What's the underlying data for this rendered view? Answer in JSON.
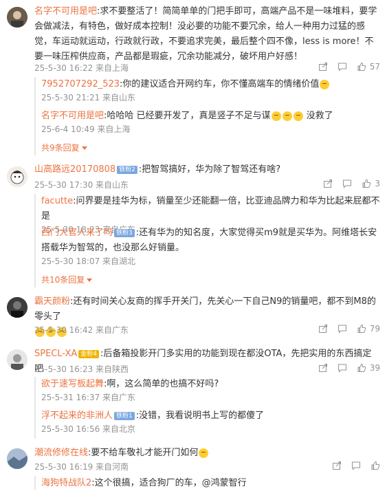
{
  "comments": [
    {
      "user": "名字不可用是吧",
      "text": ":求不要整活了！简简单单的门把手即可，高端产品不是一味堆料，要学会做减法，有特色，做好成本控制！没必要的功能不要冗余，给人一种用力过猛的感觉，车运动就运动，行政就行政，不要追求完美，最后整个四不像，less is more！不要一味压榨供应商，产品都是瑕疵，冗余功能减分，破坏用户好感！",
      "meta": "25-5-30 16:22 来自上海",
      "likes": "57",
      "replies": [
        {
          "user": "7952707292_523",
          "text": ":你的建议适合开网约车，你不懂高端车的情绪价值",
          "meta": "25-5-30 21:21 来自山东"
        },
        {
          "user": "名字不可用是吧",
          "text": ":哈哈哈 已经要开发了，真是竖子不足与谋",
          "suffix": "没救了",
          "meta": "25-6-4 10:49 来自上海"
        }
      ],
      "more": "共9条回复"
    },
    {
      "user": "山高路远20170808",
      "badge": "铁粉2",
      "text": ":把智驾搞好，华为除了智驾还有啥?",
      "meta": "25-5-30 17:30 来自山东",
      "likes": "3",
      "replies": [
        {
          "user": "facutte",
          "text": ":问界要是挂华为标，销量至少还能翻一倍，比亚迪品牌力和华为比起来屁都不是",
          "meta": "25-5-30 18:23 来自广东"
        },
        {
          "user": "西门大官人来了吗",
          "badge": "铁粉3",
          "text": ":还有华为的知名度，大家觉得买m9就是买华为。阿维塔长安搭载华为智驾的，也没那么好销量。",
          "meta": "25-5-30 18:07 来自湖北"
        }
      ],
      "more": "共10条回复"
    },
    {
      "user": "霸天颜粉",
      "text": ":还有时间关心友商的挥手开关门，先关心一下自己N9的销量吧，都不到M8的零头了",
      "meta": "25-5-30 16:42 来自广东",
      "likes": "79"
    },
    {
      "user": "SPECL-XA",
      "badge": "金粉4",
      "text": ":后备箱投影开门多实用的功能到现在都没OTA，先把实用的东西搞定吧",
      "meta": "25-5-30 16:23 来自陕西",
      "likes": "39",
      "replies": [
        {
          "user": "欲于速写板起舞",
          "text": ":啊，这么简单的也搞不好吗?",
          "meta": "25-5-31 16:37 来自广东"
        },
        {
          "user": "浮不起来的非洲人",
          "badge": "铁粉1",
          "text": ":没错，我看说明书上写的都傻了",
          "meta": "25-5-30 16:56 来自北京"
        }
      ]
    },
    {
      "user": "潮流修修在线",
      "text": ":要不给车敬礼才能开门如何",
      "meta": "25-5-30 16:19 来自河南",
      "replies": [
        {
          "user": "海狗特战队2",
          "text": ":这个很搞，适合狗厂的车，@鸿蒙智行",
          "meta": ""
        }
      ]
    }
  ],
  "colors": {
    "username": "#eb7340",
    "meta": "#939393",
    "text": "#333333"
  },
  "icons": [
    "share-icon",
    "comment-icon",
    "like-icon"
  ]
}
